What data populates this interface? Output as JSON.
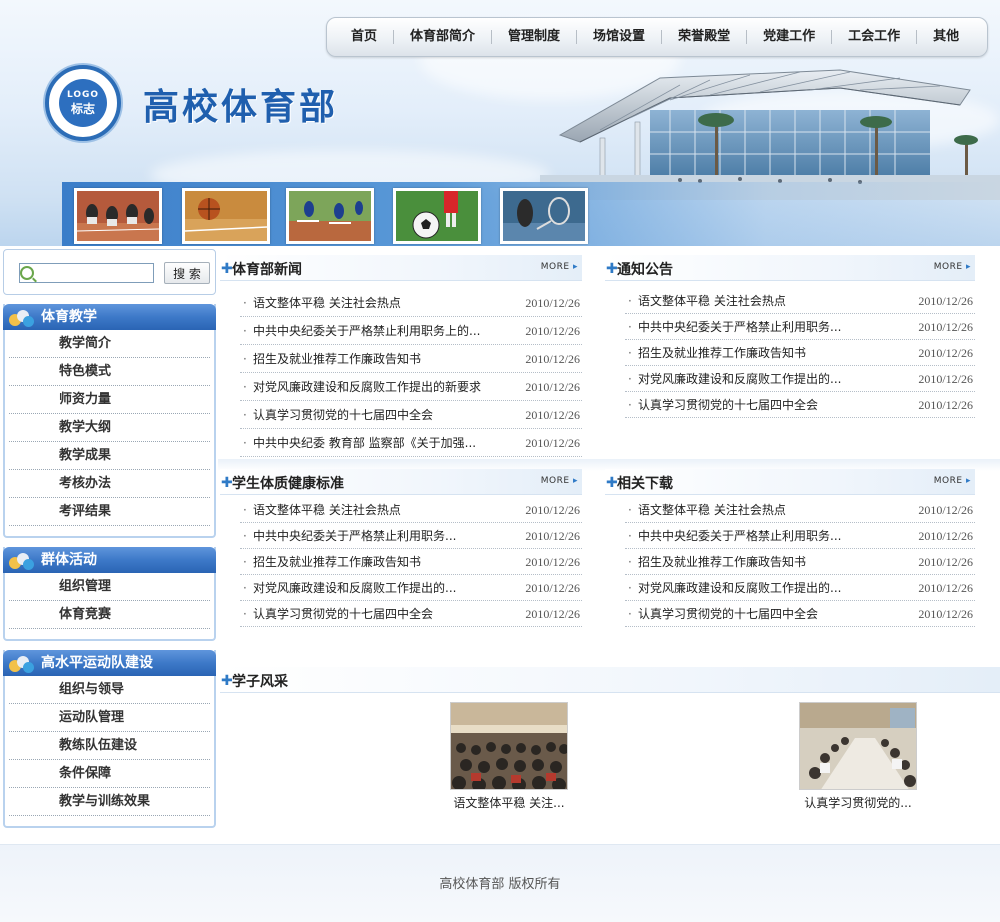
{
  "site": {
    "title": "高校体育部",
    "logo_main": "LOGO",
    "logo_sub": "标志"
  },
  "nav": {
    "items": [
      "首页",
      "体育部简介",
      "管理制度",
      "场馆设置",
      "荣誉殿堂",
      "党建工作",
      "工会工作",
      "其他"
    ]
  },
  "search": {
    "placeholder": "",
    "button": "搜 索"
  },
  "sidebar": {
    "teaching": {
      "title": "体育教学",
      "items": [
        "教学简介",
        "特色模式",
        "师资力量",
        "教学大纲",
        "教学成果",
        "考核办法",
        "考评结果"
      ]
    },
    "group": {
      "title": "群体活动",
      "items": [
        "组织管理",
        "体育竞赛"
      ]
    },
    "elite": {
      "title": "高水平运动队建设",
      "items": [
        "组织与领导",
        "运动队管理",
        "教练队伍建设",
        "条件保障",
        "教学与训练效果"
      ]
    }
  },
  "more_label": "MORE",
  "sections": {
    "news": {
      "title": "体育部新闻",
      "items": [
        {
          "text": "语文整体平稳 关注社会热点",
          "date": "2010/12/26"
        },
        {
          "text": "中共中央纪委关于严格禁止利用职务上的...",
          "date": "2010/12/26"
        },
        {
          "text": "招生及就业推荐工作廉政告知书",
          "date": "2010/12/26"
        },
        {
          "text": "对党风廉政建设和反腐败工作提出的新要求",
          "date": "2010/12/26"
        },
        {
          "text": "认真学习贯彻党的十七届四中全会",
          "date": "2010/12/26"
        },
        {
          "text": "中共中央纪委 教育部 监察部《关于加强...",
          "date": "2010/12/26"
        }
      ]
    },
    "notice": {
      "title": "通知公告",
      "items": [
        {
          "text": "语文整体平稳 关注社会热点",
          "date": "2010/12/26"
        },
        {
          "text": "中共中央纪委关于严格禁止利用职务...",
          "date": "2010/12/26"
        },
        {
          "text": "招生及就业推荐工作廉政告知书",
          "date": "2010/12/26"
        },
        {
          "text": "对党风廉政建设和反腐败工作提出的...",
          "date": "2010/12/26"
        },
        {
          "text": "认真学习贯彻党的十七届四中全会",
          "date": "2010/12/26"
        }
      ]
    },
    "health": {
      "title": "学生体质健康标准",
      "items": [
        {
          "text": "语文整体平稳 关注社会热点",
          "date": "2010/12/26"
        },
        {
          "text": "中共中央纪委关于严格禁止利用职务...",
          "date": "2010/12/26"
        },
        {
          "text": "招生及就业推荐工作廉政告知书",
          "date": "2010/12/26"
        },
        {
          "text": "对党风廉政建设和反腐败工作提出的...",
          "date": "2010/12/26"
        },
        {
          "text": "认真学习贯彻党的十七届四中全会",
          "date": "2010/12/26"
        }
      ]
    },
    "download": {
      "title": "相关下载",
      "items": [
        {
          "text": "语文整体平稳 关注社会热点",
          "date": "2010/12/26"
        },
        {
          "text": "中共中央纪委关于严格禁止利用职务...",
          "date": "2010/12/26"
        },
        {
          "text": "招生及就业推荐工作廉政告知书",
          "date": "2010/12/26"
        },
        {
          "text": "对党风廉政建设和反腐败工作提出的...",
          "date": "2010/12/26"
        },
        {
          "text": "认真学习贯彻党的十七届四中全会",
          "date": "2010/12/26"
        }
      ]
    },
    "students": {
      "title": "学子风采",
      "items": [
        {
          "caption": "语文整体平稳 关注..."
        },
        {
          "caption": "认真学习贯彻党的..."
        }
      ]
    }
  },
  "footer": {
    "copyright": "高校体育部  版权所有"
  },
  "colors": {
    "brand_blue": "#1f5fae",
    "side_head": "#3d79c8",
    "accent_plus": "#2f7ac6"
  }
}
